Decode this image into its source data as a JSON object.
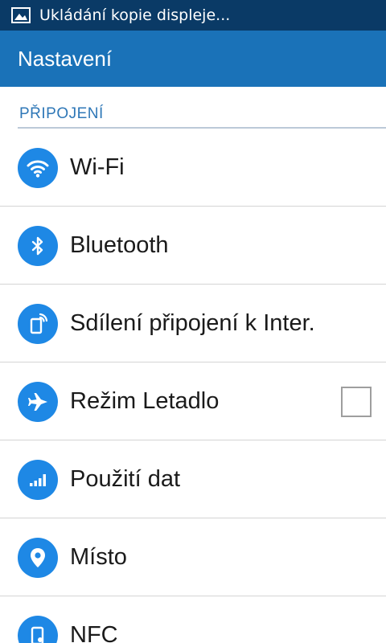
{
  "status_bar": {
    "notification_text": "Ukládání kopie displeje..."
  },
  "action_bar": {
    "title": "Nastavení"
  },
  "section": {
    "header": "PŘIPOJENÍ"
  },
  "items": [
    {
      "label": "Wi-Fi",
      "icon": "wifi-icon"
    },
    {
      "label": "Bluetooth",
      "icon": "bluetooth-icon"
    },
    {
      "label": "Sdílení připojení k Inter.",
      "icon": "tethering-icon"
    },
    {
      "label": "Režim Letadlo",
      "icon": "airplane-icon",
      "checked": false
    },
    {
      "label": "Použití dat",
      "icon": "data-usage-icon"
    },
    {
      "label": "Místo",
      "icon": "location-icon"
    },
    {
      "label": "NFC",
      "icon": "nfc-icon"
    }
  ],
  "colors": {
    "status_bar": "#0a3a66",
    "action_bar": "#1a72b8",
    "accent": "#1e88e5",
    "section_header": "#2e77b7"
  }
}
